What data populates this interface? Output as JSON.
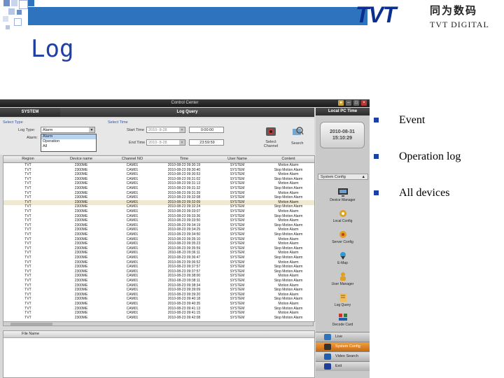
{
  "slide": {
    "title": "Log",
    "logo": {
      "main": "TVT",
      "cn": "同为数码",
      "sub": "TVT DIGITAL"
    },
    "bullets": [
      "Event",
      "Operation log",
      "All devices"
    ],
    "colors": {
      "title": "#1d3fa6",
      "bar": "#2e73bd",
      "logo": "#0b2f8f"
    }
  },
  "app": {
    "window_title": "Control Center",
    "tabs": {
      "system": "SYSTEM",
      "log_query": "Log Query"
    },
    "filter": {
      "select_type": "Select Type",
      "log_type_label": "Log Type:",
      "log_type_value": "Alarm",
      "alarm_label": "Alarm:",
      "alarm_options": [
        "Alarm",
        "Operation",
        "All"
      ],
      "alarm_selected": "Alarm",
      "select_time": "Select Time",
      "start_time_label": "Start Time",
      "start_date": "2010- 8-28",
      "start_time": "0:00:00",
      "end_time_label": "End Time",
      "end_date": "2010- 8-28",
      "end_time": "23:59:59",
      "select_channel": "Select Channel",
      "search": "Search"
    },
    "grid": {
      "columns": [
        "Region",
        "Device name",
        "Channel NO",
        "Time",
        "User Name",
        "Content"
      ],
      "rows": [
        [
          "TVT",
          "2300ME",
          "CAM01",
          "2010-08-23 09:30:19",
          "SYSTEM",
          "Motion Alarm"
        ],
        [
          "TVT",
          "2300ME",
          "CAM01",
          "2010-08-23 09:30:40",
          "SYSTEM",
          "Stop Motion Alarm"
        ],
        [
          "TVT",
          "2300ME",
          "CAM01",
          "2010-08-23 09:30:53",
          "SYSTEM",
          "Motion Alarm"
        ],
        [
          "TVT",
          "2300ME",
          "CAM01",
          "2010-08-23 09:31:02",
          "SYSTEM",
          "Stop Motion Alarm"
        ],
        [
          "TVT",
          "2300ME",
          "CAM01",
          "2010-08-23 09:31:13",
          "SYSTEM",
          "Motion Alarm"
        ],
        [
          "TVT",
          "2300ME",
          "CAM01",
          "2010-08-23 09:31:32",
          "SYSTEM",
          "Stop Motion Alarm"
        ],
        [
          "TVT",
          "2300ME",
          "CAM01",
          "2010-08-23 09:31:39",
          "SYSTEM",
          "Motion Alarm"
        ],
        [
          "TVT",
          "2300ME",
          "CAM01",
          "2010-08-23 09:32:08",
          "SYSTEM",
          "Stop Motion Alarm"
        ],
        [
          "TVT",
          "2300ME",
          "CAM01",
          "2010-08-23 09:32:09",
          "SYSTEM",
          "Motion Alarm"
        ],
        [
          "TVT",
          "2300ME",
          "CAM01",
          "2010-08-23 09:32:24",
          "SYSTEM",
          "Stop Motion Alarm"
        ],
        [
          "TVT",
          "2300ME",
          "CAM01",
          "2010-08-23 09:33:07",
          "SYSTEM",
          "Motion Alarm"
        ],
        [
          "TVT",
          "2300ME",
          "CAM01",
          "2010-08-23 09:33:36",
          "SYSTEM",
          "Stop Motion Alarm"
        ],
        [
          "TVT",
          "2300ME",
          "CAM01",
          "2010-08-23 09:33:50",
          "SYSTEM",
          "Motion Alarm"
        ],
        [
          "TVT",
          "2300ME",
          "CAM01",
          "2010-08-23 09:34:19",
          "SYSTEM",
          "Stop Motion Alarm"
        ],
        [
          "TVT",
          "2300ME",
          "CAM01",
          "2010-08-23 09:34:25",
          "SYSTEM",
          "Motion Alarm"
        ],
        [
          "TVT",
          "2300ME",
          "CAM01",
          "2010-08-23 09:34:50",
          "SYSTEM",
          "Stop Motion Alarm"
        ],
        [
          "TVT",
          "2300ME",
          "CAM01",
          "2010-08-23 09:35:10",
          "SYSTEM",
          "Motion Alarm"
        ],
        [
          "TVT",
          "2300ME",
          "CAM01",
          "2010-08-23 09:35:23",
          "SYSTEM",
          "Motion Alarm"
        ],
        [
          "TVT",
          "2300ME",
          "CAM01",
          "2010-08-23 09:35:59",
          "SYSTEM",
          "Stop Motion Alarm"
        ],
        [
          "TVT",
          "2300ME",
          "CAM01",
          "2010-08-23 09:36:11",
          "SYSTEM",
          "Motion Alarm"
        ],
        [
          "TVT",
          "2300ME",
          "CAM01",
          "2010-08-23 09:36:47",
          "SYSTEM",
          "Stop Motion Alarm"
        ],
        [
          "TVT",
          "2300ME",
          "CAM01",
          "2010-08-23 09:36:52",
          "SYSTEM",
          "Motion Alarm"
        ],
        [
          "TVT",
          "2300ME",
          "CAM01",
          "2010-08-23 09:37:57",
          "SYSTEM",
          "Stop Motion Alarm"
        ],
        [
          "TVT",
          "2300ME",
          "CAM01",
          "2010-08-23 09:37:57",
          "SYSTEM",
          "Stop Motion Alarm"
        ],
        [
          "TVT",
          "2300ME",
          "CAM01",
          "2010-08-23 09:38:00",
          "SYSTEM",
          "Motion Alarm"
        ],
        [
          "TVT",
          "2300ME",
          "CAM01",
          "2010-08-23 09:38:11",
          "SYSTEM",
          "Stop Motion Alarm"
        ],
        [
          "TVT",
          "2300ME",
          "CAM01",
          "2010-08-23 09:38:34",
          "SYSTEM",
          "Motion Alarm"
        ],
        [
          "TVT",
          "2300ME",
          "CAM01",
          "2010-08-23 09:39:09",
          "SYSTEM",
          "Stop Motion Alarm"
        ],
        [
          "TVT",
          "2300ME",
          "CAM01",
          "2010-08-23 09:39:20",
          "SYSTEM",
          "Motion Alarm"
        ],
        [
          "TVT",
          "2300ME",
          "CAM01",
          "2010-08-23 09:40:18",
          "SYSTEM",
          "Stop Motion Alarm"
        ],
        [
          "TVT",
          "2300ME",
          "CAM01",
          "2010-08-23 09:40:35",
          "SYSTEM",
          "Motion Alarm"
        ],
        [
          "TVT",
          "2300ME",
          "CAM01",
          "2010-08-23 09:41:13",
          "SYSTEM",
          "Stop Motion Alarm"
        ],
        [
          "TVT",
          "2300ME",
          "CAM01",
          "2010-08-23 09:41:15",
          "SYSTEM",
          "Motion Alarm"
        ],
        [
          "TVT",
          "2300ME",
          "CAM01",
          "2010-08-23 09:42:08",
          "SYSTEM",
          "Stop Motion Alarm"
        ]
      ],
      "highlight_row": 8
    },
    "file_panel": {
      "header": "File Name"
    },
    "side": {
      "local_pc_time": "Local PC Time",
      "date": "2010-08-31",
      "time": "15:10:29",
      "system_config": "System Config",
      "nav": [
        "Device Manager",
        "Local Config",
        "Server Config",
        "E-Map",
        "User Manager",
        "Log Query",
        "Decode Card"
      ],
      "bottom": [
        "Live",
        "System Config",
        "Video Search",
        "Exit"
      ]
    }
  }
}
